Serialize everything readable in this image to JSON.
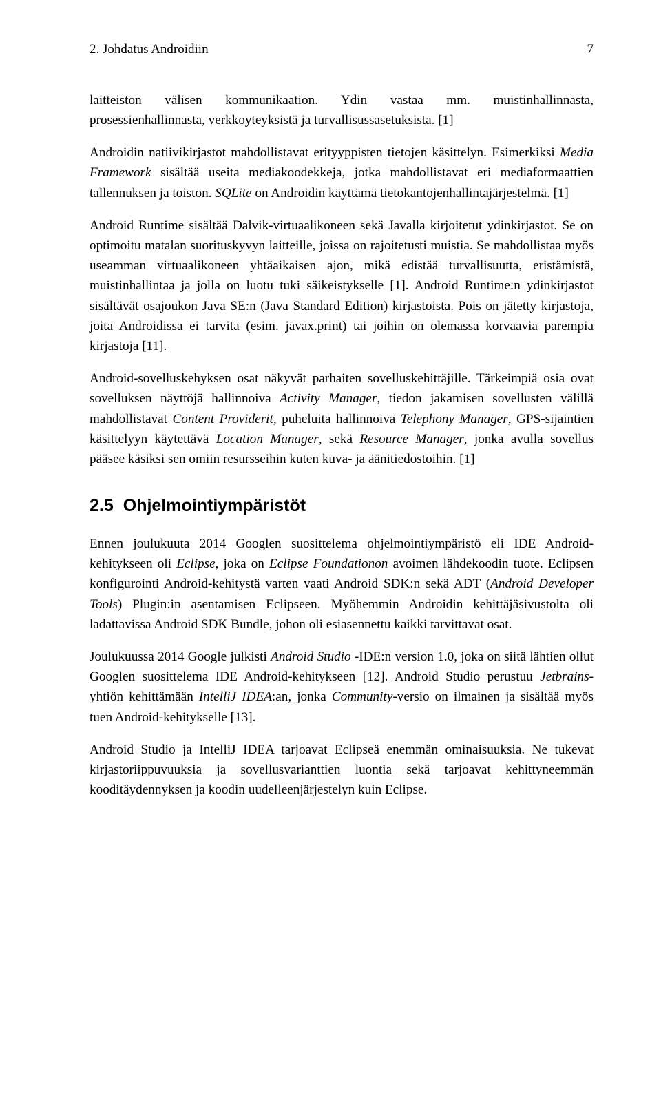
{
  "header": {
    "chapter_label": "2. Johdatus Androidiin",
    "page_number": "7"
  },
  "paragraphs": {
    "p1": "laitteiston välisen kommunikaation. Ydin vastaa mm. muistinhallinnasta, prosessienhallinnasta, verkkoyteyksistä ja turvallisussasetuksista. [1]",
    "p2a": "Androidin natiivikirjastot mahdollistavat erityyppisten tietojen käsittelyn. Esimerkiksi ",
    "p2_media": "Media Framework",
    "p2b": " sisältää useita mediakoodekkeja, jotka mahdollistavat eri mediaformaattien tallennuksen ja toiston. ",
    "p2_sqlite": "SQLite",
    "p2c": " on Androidin käyttämä tietokantojenhallintajärjestelmä. [1]",
    "p3": "Android Runtime sisältää Dalvik-virtuaalikoneen sekä Javalla kirjoitetut ydinkirjastot. Se on optimoitu matalan suorituskyvyn laitteille, joissa on rajoitetusti muistia. Se mahdollistaa myös useamman virtuaalikoneen yhtäaikaisen ajon, mikä edistää turvallisuutta, eristämistä, muistinhallintaa ja jolla on luotu tuki säikeistykselle [1]. Android Runtime:n ydinkirjastot sisältävät osajoukon Java SE:n (Java Standard Edition) kirjastoista. Pois on jätetty kirjastoja, joita Androidissa ei tarvita (esim. javax.print) tai joihin on olemassa korvaavia parempia kirjastoja [11].",
    "p4a": "Android-sovelluskehyksen osat näkyvät parhaiten sovelluskehittäjille. Tärkeimpiä osia ovat sovelluksen näyttöjä hallinnoiva ",
    "p4_activity": "Activity Manager",
    "p4b": ", tiedon jakamisen sovellusten välillä mahdollistavat ",
    "p4_content": "Content Providerit",
    "p4c": ", puheluita hallinnoiva ",
    "p4_telephony": "Telephony Manager",
    "p4d": ", GPS-sijaintien käsittelyyn käytettävä ",
    "p4_location": "Location Manager",
    "p4e": ", sekä ",
    "p4_resource": "Resource Manager",
    "p4f": ", jonka avulla sovellus pääsee käsiksi sen omiin resursseihin kuten kuva- ja äänitiedostoihin. [1]",
    "p5a": "Ennen joulukuuta 2014 Googlen suosittelema ohjelmointiympäristö eli IDE Android-kehitykseen oli ",
    "p5_eclipse": "Eclipse",
    "p5b": ", joka on ",
    "p5_foundation": "Eclipse Foundationon",
    "p5c": " avoimen lähdekoodin tuote. Eclipsen konfigurointi Android-kehitystä varten vaati Android SDK:n sekä ADT (",
    "p5_adt": "Android Developer Tools",
    "p5d": ") Plugin:in asentamisen Eclipseen. Myöhemmin Androidin kehittäjäsivustolta oli ladattavissa Android SDK Bundle, johon oli esiasennettu kaikki tarvittavat osat.",
    "p6a": "Joulukuussa 2014 Google julkisti ",
    "p6_studio": "Android Studio",
    "p6b": " -IDE:n version 1.0, joka on siitä lähtien ollut Googlen suosittelema IDE Android-kehitykseen [12]. Android Studio perustuu ",
    "p6_jetbrains": "Jetbrains",
    "p6c": "-yhtiön kehittämään ",
    "p6_intellij": "IntelliJ IDEA",
    "p6d": ":an, jonka ",
    "p6_community": "Community",
    "p6e": "-versio on ilmainen ja sisältää myös tuen Android-kehitykselle [13].",
    "p7": "Android Studio ja IntelliJ IDEA tarjoavat Eclipseä enemmän ominaisuuksia. Ne tukevat kirjastoriippuvuuksia ja sovellusvarianttien luontia sekä tarjoavat kehittyneemmän kooditäydennyksen ja koodin uudelleenjärjestelyn kuin Eclipse."
  },
  "section": {
    "number": "2.5",
    "title": "Ohjelmointiympäristöt"
  }
}
